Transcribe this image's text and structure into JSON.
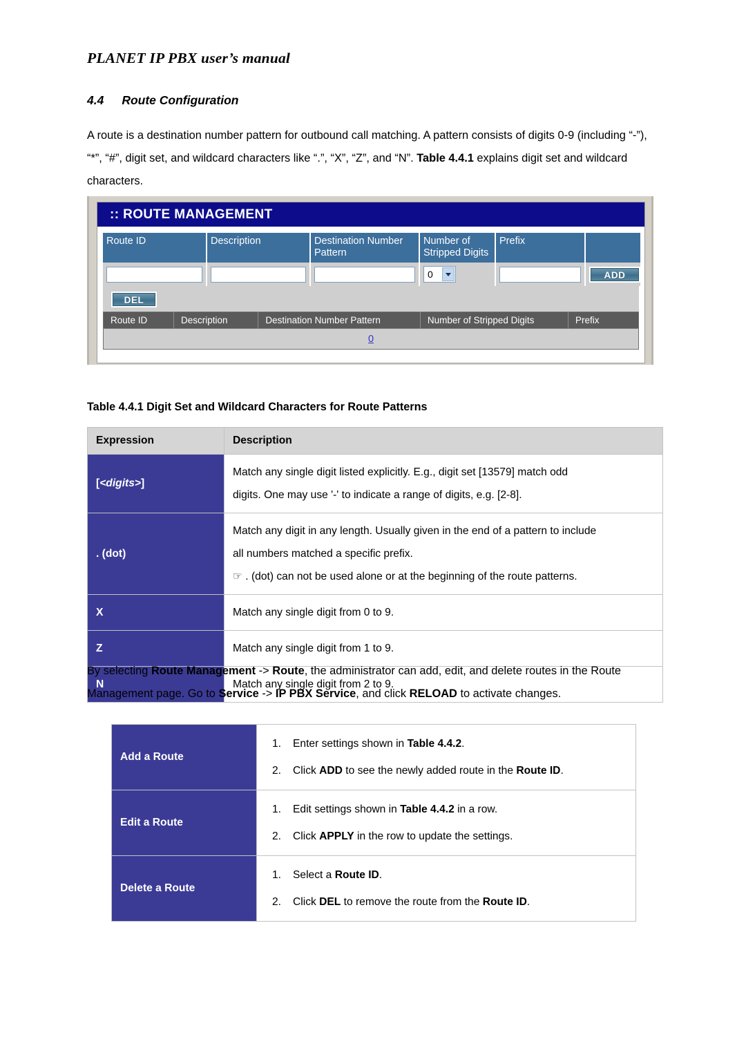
{
  "doc": {
    "running_header": "PLANET IP PBX user’s manual",
    "section_number": "4.4",
    "section_title": "Route Configuration",
    "intro_paragraph": "A route is a destination number pattern for outbound call matching. A pattern consists of digits 0-9 (including “-”), “*”, “#”, digit set, and wildcard characters like “.”, “X”, “Z”, and “N”. Table 4.4.1 explains digit set and wildcard characters.",
    "intro_parts": {
      "p1": "A route is a destination number pattern for outbound call matching. A pattern consists of digits 0-9 (including “-”), “*”, “#”, digit set, and wildcard characters like “.”, “X”, “Z”, and “N”. ",
      "bold1": "Table 4.4.1",
      "p2": " explains digit set and wildcard characters."
    },
    "after_paragraph_parts": {
      "a1": "By selecting ",
      "b1": "Route Management",
      "a2": " -> ",
      "b2": "Route",
      "a3": ", the administrator can add, edit, and delete routes in the Route Management page. Go to ",
      "b3": "Service",
      "a4": " -> ",
      "b4": "IP PBX Service",
      "a5": ", and click ",
      "b5": "RELOAD",
      "a6": " to activate changes."
    }
  },
  "screenshot": {
    "panel_title": ":: ROUTE MANAGEMENT",
    "form_headers": [
      "Route ID",
      "Description",
      "Destination Number Pattern",
      "Number of Stripped Digits",
      "Prefix",
      ""
    ],
    "form_values": {
      "route_id": "",
      "description": "",
      "destination_number_pattern": "",
      "stripped_digits": "0",
      "prefix": ""
    },
    "add_button_label": "ADD",
    "del_button_label": "DEL",
    "list_headers": [
      "Route ID",
      "Description",
      "Destination Number Pattern",
      "Number of Stripped Digits",
      "Prefix"
    ],
    "list_rows": [
      {
        "link": "0"
      }
    ],
    "colors": {
      "panel_title_bg": "#0d0d8c",
      "form_header_bg": "#3c6f9c",
      "list_header_bg": "#5a5a5a",
      "body_bg": "#cfcfcf",
      "link": "#3333cc"
    }
  },
  "table_441": {
    "caption": "Table 4.4.1 Digit Set and Wildcard Characters for Route Patterns",
    "headers": [
      "Expression",
      "Description"
    ],
    "accent_color": "#3b3b96",
    "rows": [
      {
        "expr_prefix": "[",
        "expr_italic": "<digits>",
        "expr_suffix": "]",
        "lines": [
          "Match any single digit listed explicitly. E.g., digit set [13579] match odd",
          "digits. One may use '-' to indicate a range of digits, e.g. [2-8]."
        ]
      },
      {
        "expr_prefix": ". (dot)",
        "expr_italic": "",
        "expr_suffix": "",
        "lines": [
          "Match any digit in any length. Usually given in the end of a pattern to include",
          "all numbers matched a specific prefix.",
          "☞ . (dot) can not be used alone or at the beginning of the route patterns."
        ]
      },
      {
        "expr_prefix": "X",
        "expr_italic": "",
        "expr_suffix": "",
        "lines": [
          "Match any single digit from 0 to 9."
        ]
      },
      {
        "expr_prefix": "Z",
        "expr_italic": "",
        "expr_suffix": "",
        "lines": [
          "Match any single digit from 1 to 9."
        ]
      },
      {
        "expr_prefix": "N",
        "expr_italic": "",
        "expr_suffix": "",
        "lines": [
          "Match any single digit from 2 to 9."
        ]
      }
    ]
  },
  "ops_table": {
    "accent_color": "#3b3b96",
    "rows": [
      {
        "name": "Add a Route",
        "steps": [
          {
            "num": "1.",
            "pre": "Enter settings shown in ",
            "bold": "Table 4.4.2",
            "post": "."
          },
          {
            "num": "2.",
            "pre": "Click ",
            "bold": "ADD",
            "mid": " to see the newly added route in the ",
            "bold2": "Route ID",
            "post": "."
          }
        ]
      },
      {
        "name": "Edit a Route",
        "steps": [
          {
            "num": "1.",
            "pre": "Edit settings shown in ",
            "bold": "Table 4.4.2",
            "post": " in a row."
          },
          {
            "num": "2.",
            "pre": "Click ",
            "bold": "APPLY",
            "post": " in the row to update the settings."
          }
        ]
      },
      {
        "name": "Delete a Route",
        "steps": [
          {
            "num": "1.",
            "pre": "Select a ",
            "bold": "Route ID",
            "post": "."
          },
          {
            "num": "2.",
            "pre": "Click ",
            "bold": "DEL",
            "mid": " to remove the route from the ",
            "bold2": "Route ID",
            "post": "."
          }
        ]
      }
    ]
  }
}
